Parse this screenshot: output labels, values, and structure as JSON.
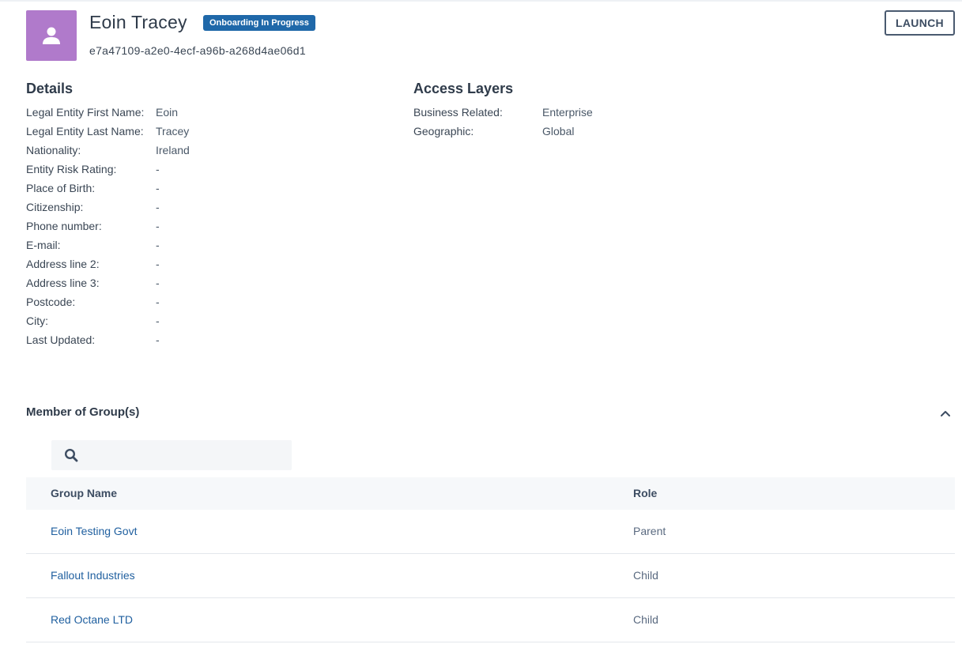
{
  "header": {
    "name": "Eoin Tracey",
    "status_badge": "Onboarding In Progress",
    "entity_id": "e7a47109-a2e0-4ecf-a96b-a268d4ae06d1",
    "launch_label": "LAUNCH",
    "avatar_color": "#b07acb",
    "badge_color": "#1f68a9"
  },
  "details": {
    "title": "Details",
    "rows": [
      {
        "label": "Legal Entity First Name:",
        "value": "Eoin"
      },
      {
        "label": "Legal Entity Last Name:",
        "value": "Tracey"
      },
      {
        "label": "Nationality:",
        "value": "Ireland"
      },
      {
        "label": "Entity Risk Rating:",
        "value": "-"
      },
      {
        "label": "Place of Birth:",
        "value": "-"
      },
      {
        "label": "Citizenship:",
        "value": "-"
      },
      {
        "label": "Phone number:",
        "value": "-"
      },
      {
        "label": "E-mail:",
        "value": "-"
      },
      {
        "label": "Address line 2:",
        "value": "-"
      },
      {
        "label": "Address line 3:",
        "value": "-"
      },
      {
        "label": "Postcode:",
        "value": "-"
      },
      {
        "label": "City:",
        "value": "-"
      },
      {
        "label": "Last Updated:",
        "value": "-"
      }
    ]
  },
  "access_layers": {
    "title": "Access Layers",
    "rows": [
      {
        "label": "Business Related:",
        "value": "Enterprise"
      },
      {
        "label": "Geographic:",
        "value": "Global"
      }
    ]
  },
  "groups": {
    "title": "Member of Group(s)",
    "search_value": "",
    "columns": {
      "name": "Group Name",
      "role": "Role"
    },
    "rows": [
      {
        "name": "Eoin Testing Govt",
        "role": "Parent"
      },
      {
        "name": "Fallout Industries",
        "role": "Child"
      },
      {
        "name": "Red Octane LTD",
        "role": "Child"
      }
    ]
  }
}
